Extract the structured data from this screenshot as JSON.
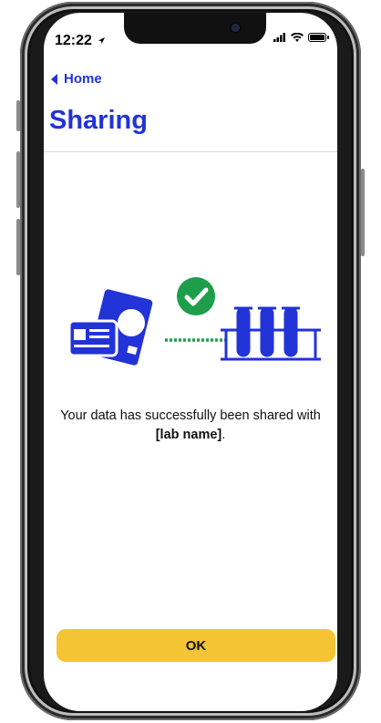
{
  "status_bar": {
    "time": "12:22",
    "location_icon": "location-arrow-icon",
    "signal_icon": "cellular-signal-icon",
    "wifi_icon": "wifi-icon",
    "battery_icon": "battery-icon"
  },
  "nav": {
    "back_label": "Home",
    "back_icon": "chevron-left-icon"
  },
  "page": {
    "title": "Sharing"
  },
  "message": {
    "text": "Your data has successfully been shared with",
    "lab_name": "[lab name]",
    "suffix": "."
  },
  "actions": {
    "ok_label": "OK"
  },
  "colors": {
    "accent": "#2233d8",
    "success": "#1e9e4a",
    "button": "#f4c434"
  }
}
